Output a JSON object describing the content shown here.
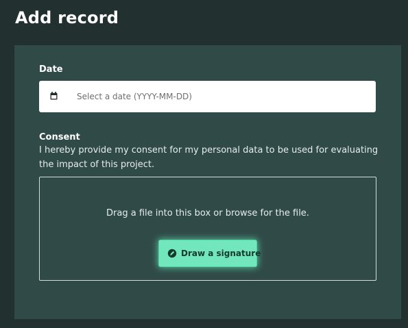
{
  "page": {
    "title": "Add record"
  },
  "form": {
    "date": {
      "label": "Date",
      "icon": "calendar-icon",
      "placeholder": "Select a date (YYYY-MM-DD)",
      "value": ""
    },
    "consent": {
      "label": "Consent",
      "text": "I hereby provide my consent for my personal data to be used for evaluating the impact of this project.",
      "dropzone_text": "Drag a file into this box or browse for the file.",
      "signature_button": {
        "label": "Draw a signature",
        "icon": "pen-icon"
      }
    }
  },
  "colors": {
    "page_background": "#223130",
    "card_background": "#304a48",
    "accent_button": "#72e6bd",
    "accent_glow": "#60e8b4",
    "button_text": "#143a2e"
  }
}
